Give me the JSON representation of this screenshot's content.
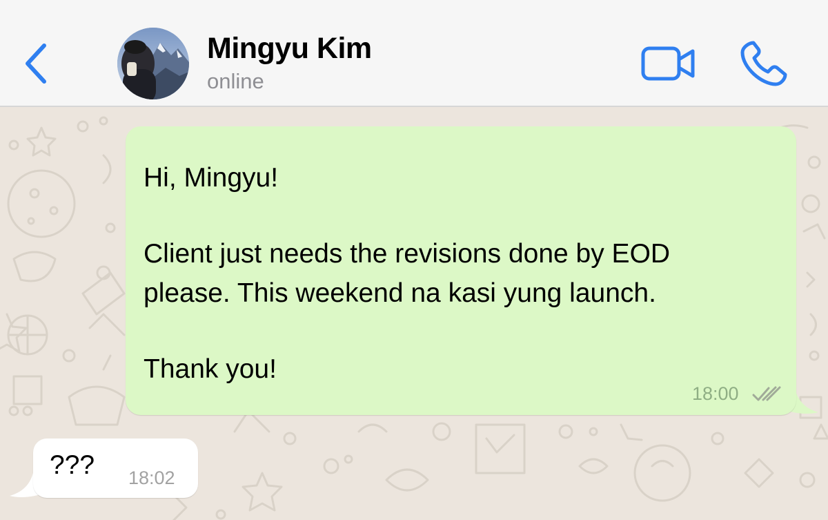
{
  "header": {
    "contact_name": "Mingyu Kim",
    "status": "online",
    "back_icon": "chevron-left-icon",
    "video_icon": "video-camera-icon",
    "call_icon": "phone-icon"
  },
  "messages": [
    {
      "direction": "outgoing",
      "lines": [
        "Hi, Mingyu!",
        "Client just needs the revisions done by EOD",
        "please. This weekend na kasi yung launch.",
        "Thank you!"
      ],
      "time": "18:00",
      "status_icon": "double-check-icon"
    },
    {
      "direction": "incoming",
      "text": "???",
      "time": "18:02"
    }
  ],
  "colors": {
    "accent": "#2f7ff0",
    "outgoing_bubble": "#dcf8c6",
    "incoming_bubble": "#ffffff",
    "wallpaper": "#ece5dd"
  }
}
